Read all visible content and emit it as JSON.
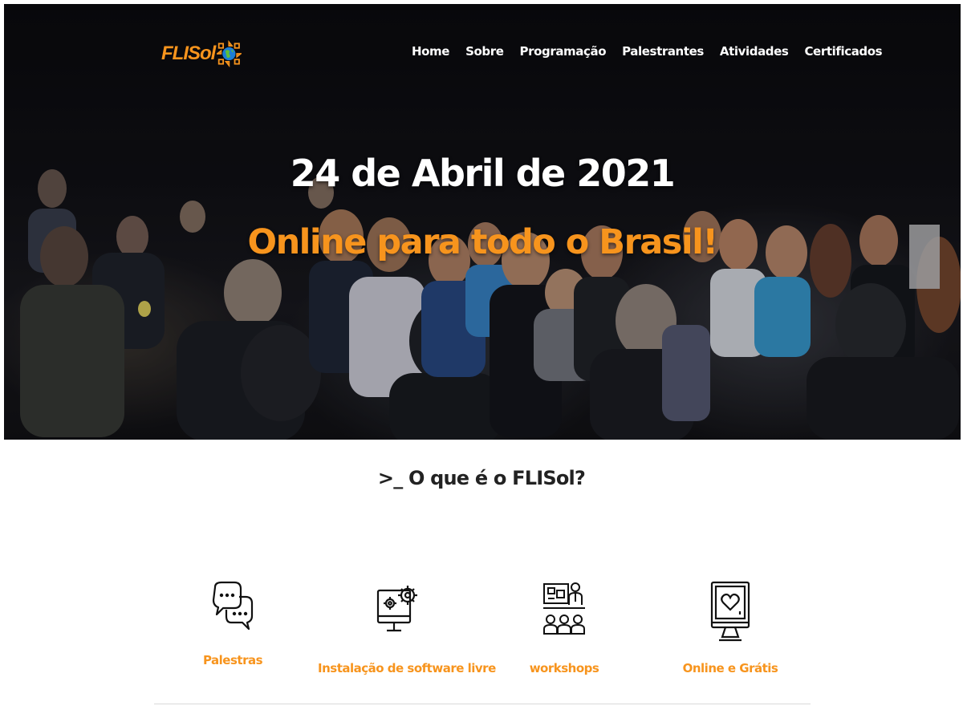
{
  "logo": {
    "text": "FLISol"
  },
  "nav": {
    "items": [
      "Home",
      "Sobre",
      "Programação",
      "Palestrantes",
      "Atividades",
      "Certificados"
    ]
  },
  "hero": {
    "date": "24 de Abril de 2021",
    "subtitle": "Online para todo o Brasil!"
  },
  "about": {
    "title": ">_ O que é o FLISol?"
  },
  "features": [
    {
      "label": "Palestras",
      "icon": "speech-bubbles-icon"
    },
    {
      "label": "Instalação de software livre",
      "icon": "monitor-gears-icon"
    },
    {
      "label": "workshops",
      "icon": "presentation-audience-icon"
    },
    {
      "label": "Online e Grátis",
      "icon": "monitor-heart-icon"
    }
  ],
  "colors": {
    "accent": "#f7941d",
    "hero_bg": "#111116",
    "title_text": "#222222"
  }
}
